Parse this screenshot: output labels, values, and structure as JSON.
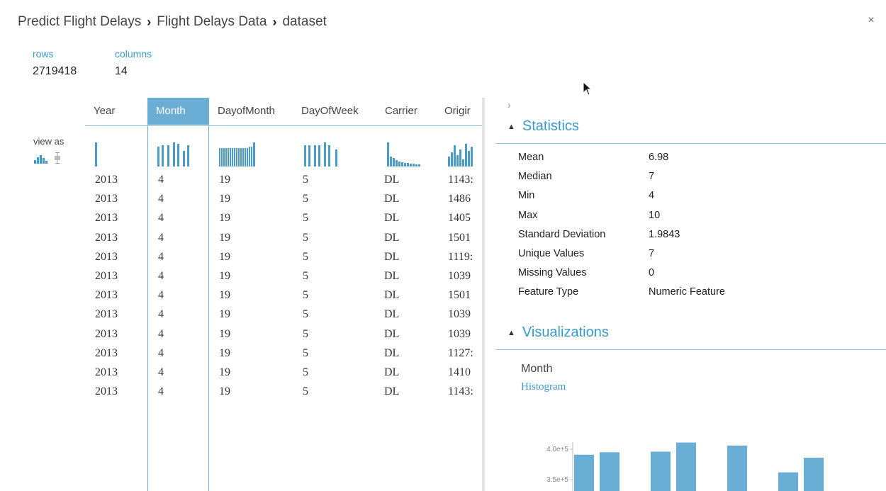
{
  "breadcrumb": {
    "part1": "Predict Flight Delays",
    "part2": "Flight Delays Data",
    "part3": "dataset",
    "separator": "›"
  },
  "close_glyph": "×",
  "summary": {
    "rows_label": "rows",
    "rows_value": "2719418",
    "columns_label": "columns",
    "columns_value": "14"
  },
  "view_as_label": "view as",
  "columns": [
    "Year",
    "Month",
    "DayofMonth",
    "DayOfWeek",
    "Carrier",
    "Origir"
  ],
  "selected_column": "Month",
  "rows": [
    [
      "2013",
      "4",
      "19",
      "5",
      "DL",
      "1143:"
    ],
    [
      "2013",
      "4",
      "19",
      "5",
      "DL",
      "1486"
    ],
    [
      "2013",
      "4",
      "19",
      "5",
      "DL",
      "1405"
    ],
    [
      "2013",
      "4",
      "19",
      "5",
      "DL",
      "1501"
    ],
    [
      "2013",
      "4",
      "19",
      "5",
      "DL",
      "1119:"
    ],
    [
      "2013",
      "4",
      "19",
      "5",
      "DL",
      "1039"
    ],
    [
      "2013",
      "4",
      "19",
      "5",
      "DL",
      "1501"
    ],
    [
      "2013",
      "4",
      "19",
      "5",
      "DL",
      "1039"
    ],
    [
      "2013",
      "4",
      "19",
      "5",
      "DL",
      "1039"
    ],
    [
      "2013",
      "4",
      "19",
      "5",
      "DL",
      "1127:"
    ],
    [
      "2013",
      "4",
      "19",
      "5",
      "DL",
      "1410"
    ],
    [
      "2013",
      "4",
      "19",
      "5",
      "DL",
      "1143:"
    ]
  ],
  "expand_glyph": "›",
  "statistics": {
    "title": "Statistics",
    "items": [
      {
        "label": "Mean",
        "value": "6.98"
      },
      {
        "label": "Median",
        "value": "7"
      },
      {
        "label": "Min",
        "value": "4"
      },
      {
        "label": "Max",
        "value": "10"
      },
      {
        "label": "Standard Deviation",
        "value": "1.9843"
      },
      {
        "label": "Unique Values",
        "value": "7"
      },
      {
        "label": "Missing Values",
        "value": "0"
      },
      {
        "label": "Feature Type",
        "value": "Numeric Feature"
      }
    ]
  },
  "visualizations": {
    "title": "Visualizations",
    "column": "Month",
    "type": "Histogram"
  },
  "histogram": {
    "y_ticks": [
      "4.0e+5",
      "3.5e+5"
    ],
    "y_values": [
      400000,
      350000
    ],
    "bars": [
      391000,
      395000,
      396000,
      411000,
      406000,
      362000,
      386000
    ],
    "bar_gaps_after": [
      0,
      2,
      0,
      2,
      2,
      0
    ]
  },
  "colors": {
    "accent": "#3a9ac9",
    "selected_header": "#6aaed6",
    "bar": "#6aaed6"
  }
}
